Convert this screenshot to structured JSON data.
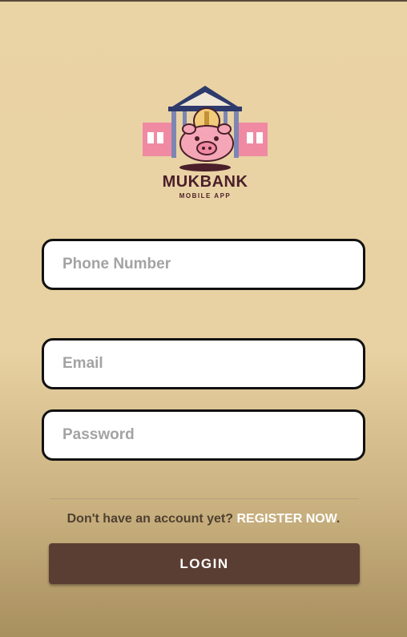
{
  "app": {
    "brand_name": "MUKBANK",
    "brand_subtitle": "MOBILE APP",
    "logo_icon": "piggy-bank-building-icon"
  },
  "form": {
    "phone_placeholder": "Phone Number",
    "phone_value": "",
    "email_placeholder": "Email",
    "email_value": "",
    "password_placeholder": "Password",
    "password_value": ""
  },
  "register": {
    "prompt": "Don't have an account yet? ",
    "link_label": "REGISTER NOW",
    "suffix": "."
  },
  "actions": {
    "login_label": "LOGIN"
  },
  "colors": {
    "background": "#ead3a5",
    "brand_text": "#4a1f2a",
    "login_button": "#5b3e33",
    "register_link": "#ffffff"
  }
}
